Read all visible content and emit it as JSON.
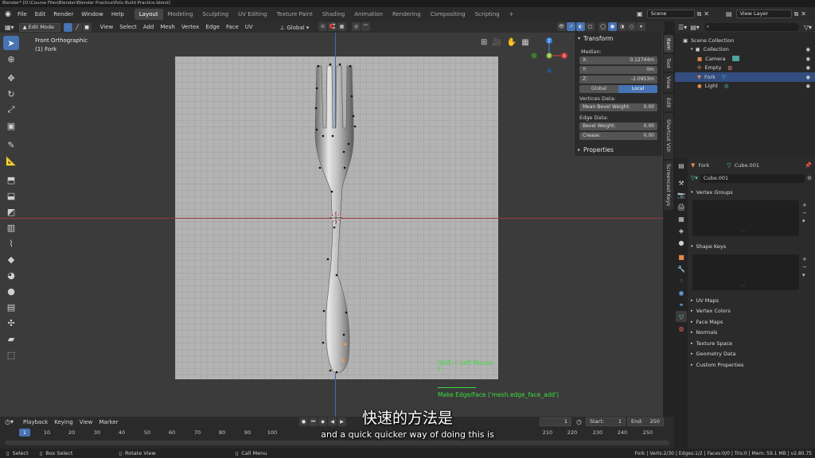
{
  "window": {
    "title": "Blender* [D:\\Course Files\\Blender\\Blender Practice\\Polu Build Practice.blend]"
  },
  "menubar": {
    "items": [
      "File",
      "Edit",
      "Render",
      "Window",
      "Help"
    ],
    "workspaces": [
      "Layout",
      "Modeling",
      "Sculpting",
      "UV Editing",
      "Texture Paint",
      "Shading",
      "Animation",
      "Rendering",
      "Compositing",
      "Scripting"
    ],
    "active_workspace": "Layout",
    "add_tab": "+",
    "scene_label": "Scene",
    "view_layer_label": "View Layer"
  },
  "viewport_header": {
    "mode": "Edit Mode",
    "menus": [
      "View",
      "Select",
      "Add",
      "Mesh",
      "Vertex",
      "Edge",
      "Face",
      "UV"
    ],
    "orientation": "Global"
  },
  "viewport": {
    "view_name": "Front Orthographic",
    "object_name": "(1) Fork",
    "gizmo_z": "Z",
    "gizmo_x": "X",
    "gizmo_y": "Y",
    "operator_hint_line1": "Shift + Left Mouse",
    "operator_hint_line2": "F",
    "operator_name": "Make Edge/Face ('mesh.edge_face_add')"
  },
  "npanel": {
    "transform_title": "Transform",
    "median_label": "Median:",
    "x_label": "X:",
    "x_value": "0.12744m",
    "y_label": "Y:",
    "y_value": "0m",
    "z_label": "Z:",
    "z_value": "-2.0953m",
    "global_label": "Global",
    "local_label": "Local",
    "vertices_data_label": "Vertices Data:",
    "mean_bevel_label": "Mean Bevel Weight:",
    "mean_bevel_value": "0.00",
    "edge_data_label": "Edge Data:",
    "bevel_weight_label": "Bevel Weight:",
    "bevel_weight_value": "0.00",
    "crease_label": "Crease:",
    "crease_value": "0.00",
    "properties_label": "Properties",
    "tabs": [
      "Item",
      "Tool",
      "View",
      "Edit",
      "Shortcut VUr",
      "Screencast Keys"
    ]
  },
  "outliner": {
    "scene_collection": "Scene Collection",
    "collection": "Collection",
    "items": [
      "Camera",
      "Empty",
      "Fork",
      "Light"
    ]
  },
  "properties": {
    "object_name": "Fork",
    "mesh_name": "Cube.001",
    "data_field": "Cube.001",
    "vertex_groups": "Vertex Groups",
    "shape_keys": "Shape Keys",
    "sections": [
      "UV Maps",
      "Vertex Colors",
      "Face Maps",
      "Normals",
      "Texture Space",
      "Geometry Data",
      "Custom Properties"
    ]
  },
  "timeline": {
    "menus": [
      "Playback",
      "Keying",
      "View",
      "Marker"
    ],
    "current_frame": "1",
    "start_label": "Start:",
    "start_value": "1",
    "end_label": "End:",
    "end_value": "250",
    "ticks": [
      "1",
      "10",
      "20",
      "30",
      "40",
      "50",
      "60",
      "70",
      "80",
      "90",
      "100",
      "210",
      "220",
      "230",
      "240",
      "250"
    ]
  },
  "subtitles": {
    "chinese": "快速的方法是",
    "english": "and a quick quicker way of doing this is"
  },
  "statusbar": {
    "select": "Select",
    "box_select": "Box Select",
    "rotate_view": "Rotate View",
    "call_menu": "Call Menu",
    "stats": "Fork | Verts:2/30 | Edges:1/2 | Faces:0/0 | Tris:0 | Mem: 59.1 MB | v2.80.75"
  },
  "colors": {
    "accent": "#4772b3",
    "selected_row": "#334d80",
    "operator_text": "#3ddc3d"
  }
}
